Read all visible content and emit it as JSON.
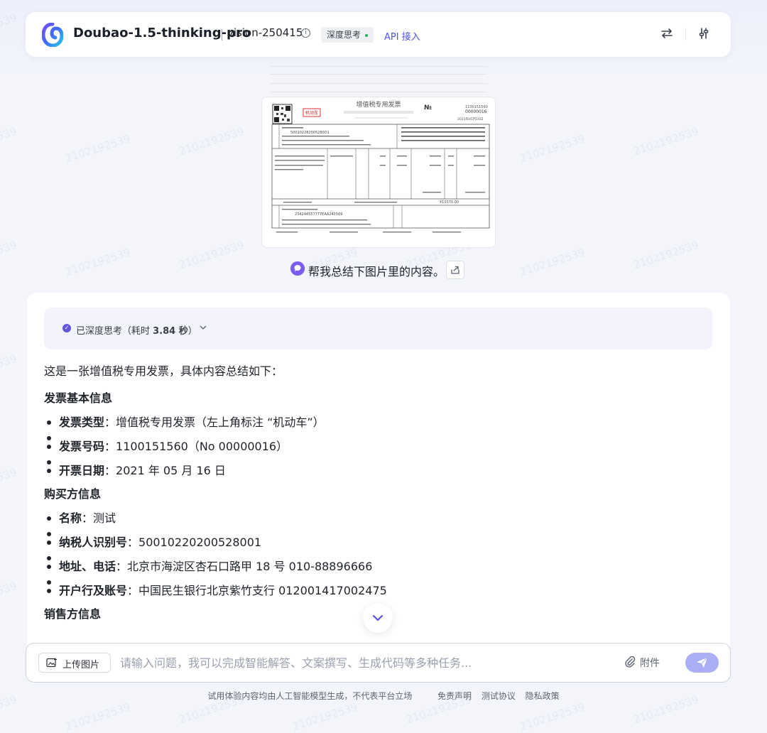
{
  "header": {
    "model_name": "Doubao-1.5-thinking-pro",
    "model_version": "vision-250415",
    "deep_think_badge": "深度思考",
    "api_link": "API 接入"
  },
  "invoice": {
    "title": "增值税专用发票",
    "motor_tag": "机动车",
    "no_label": "№",
    "code": "1100151560",
    "number": "00000016",
    "date": "2021年05月16日",
    "buyer_tax_id": "500102282005280O1",
    "seller_tax_id": "234244557777EAA245509",
    "total_tax": "¥10370.00"
  },
  "question": {
    "text": "帮我总结下图片里的内容。"
  },
  "answer": {
    "thinking": {
      "label": "已深度思考（耗时 ",
      "time": "3.84 秒",
      "suffix": "）"
    },
    "intro": "这是一张增值税专用发票，具体内容总结如下：",
    "sections": [
      {
        "title": "发票基本信息",
        "items": [
          {
            "key": "发票类型",
            "value": "：增值税专用发票（左上角标注 “机动车”）"
          },
          {
            "key": "发票号码",
            "value": "：1100151560（No 00000016）"
          },
          {
            "key": "开票日期",
            "value": "：2021 年 05 月 16 日"
          }
        ]
      },
      {
        "title": "购买方信息",
        "items": [
          {
            "key": "名称",
            "value": "：测试"
          },
          {
            "key": "纳税人识别号",
            "value": "：50010220200528001"
          },
          {
            "key": "地址、电话",
            "value": "：北京市海淀区杏石口路甲 18 号 010-88896666"
          },
          {
            "key": "开户行及账号",
            "value": "：中国民生银行北京紫竹支行 012001417002475"
          }
        ]
      },
      {
        "title": "销售方信息",
        "items": []
      }
    ]
  },
  "input": {
    "upload_label": "上传图片",
    "placeholder": "请输入问题，我可以完成智能解答、文案撰写、生成代码等多种任务...",
    "attach_label": "附件"
  },
  "footer": {
    "disclaimer": "试用体验内容均由人工智能模型生成，不代表平台立场",
    "link_disclaimer": "免责声明",
    "link_terms": "测试协议",
    "link_privacy": "隐私政策"
  },
  "watermark": "2102192539",
  "colors": {
    "accent": "#4d53e8",
    "send_button": "#a9aef5",
    "thinking_bg": "#f3f4fb",
    "page_bg": "#f3f5fb"
  }
}
